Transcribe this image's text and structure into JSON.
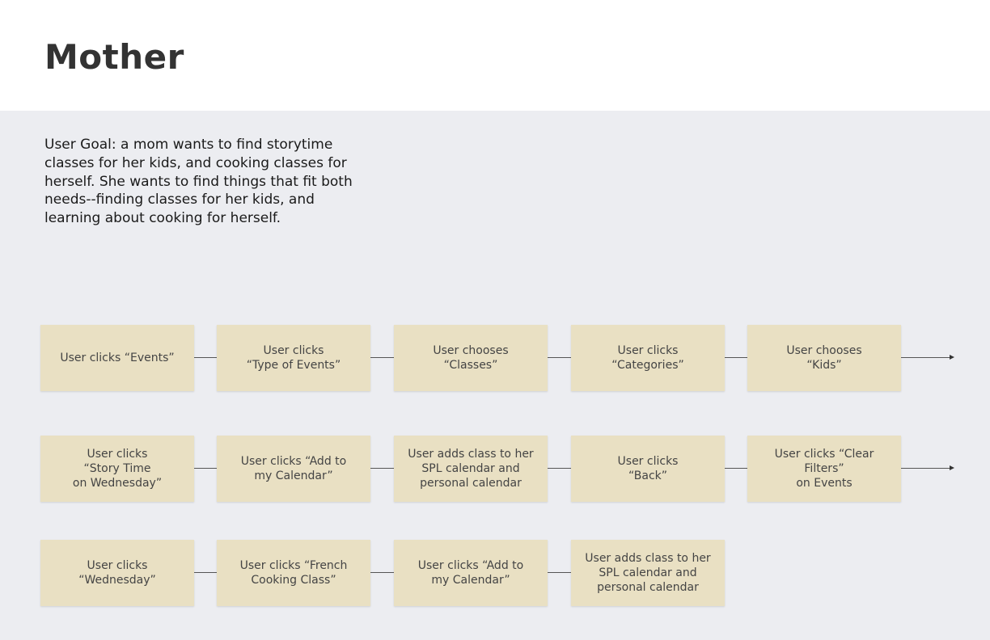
{
  "header": {
    "title": "Mother"
  },
  "goal": {
    "text": "User Goal: a mom wants to find storytime classes for her kids, and cooking classes for herself. She wants to find things that fit both needs--finding classes for her kids, and learning about cooking for herself."
  },
  "flow": {
    "rows": [
      {
        "steps": [
          {
            "label": "User clicks “Events”"
          },
          {
            "label": "User clicks\n“Type of Events”"
          },
          {
            "label": "User chooses\n“Classes”"
          },
          {
            "label": "User clicks\n“Categories”"
          },
          {
            "label": "User chooses\n“Kids”"
          }
        ]
      },
      {
        "steps": [
          {
            "label": "User clicks\n“Story Time\non Wednesday”"
          },
          {
            "label": "User clicks “Add to\nmy Calendar”"
          },
          {
            "label": "User adds class to her\nSPL calendar and\npersonal calendar"
          },
          {
            "label": "User clicks\n“Back”"
          },
          {
            "label": "User clicks “Clear Filters”\non Events"
          }
        ]
      },
      {
        "steps": [
          {
            "label": "User clicks\n“Wednesday”"
          },
          {
            "label": "User clicks “French\nCooking Class”"
          },
          {
            "label": "User clicks “Add to\nmy Calendar”"
          },
          {
            "label": "User adds class to her\nSPL calendar and\npersonal calendar"
          }
        ]
      }
    ]
  }
}
